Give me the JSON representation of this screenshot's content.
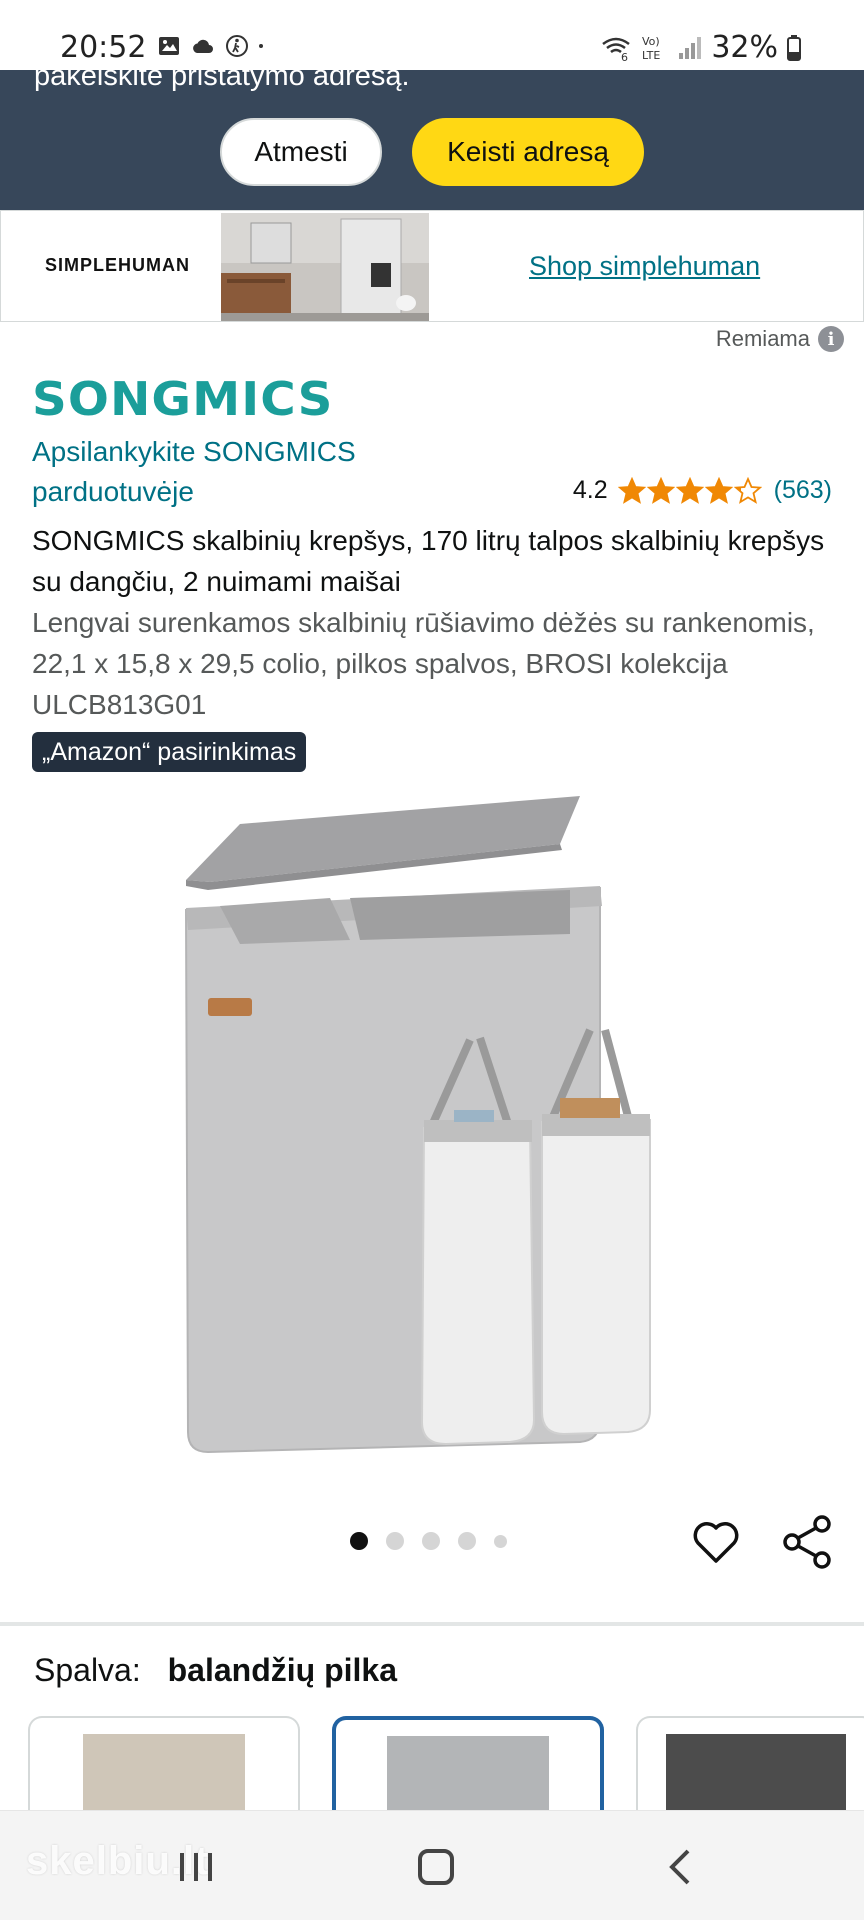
{
  "status_bar": {
    "time": "20:52",
    "battery": "32%",
    "network": "LTE",
    "icons": [
      "gallery-icon",
      "cloud-icon",
      "accessibility-icon",
      "wifi-calling-icon",
      "volte-icon",
      "signal-icon",
      "battery-icon"
    ]
  },
  "address_banner": {
    "text": "pakeiskite pristatymo adresą.",
    "dismiss_label": "Atmesti",
    "change_label": "Keisti adresą"
  },
  "brand_ad": {
    "logo_text": "SIMPLEHUMAN",
    "link_text": "Shop simplehuman"
  },
  "sponsored": {
    "label": "Remiama",
    "icon": "info-icon"
  },
  "product": {
    "brand_logo": "SONGMICS",
    "store_link": "Apsilankykite SONGMICS parduotuvėje",
    "rating_value": "4.2",
    "rating_stars": 4.2,
    "rating_count": "(563)",
    "title": "SONGMICS skalbinių krepšys, 170 litrų talpos skalbinių krepšys su dangčiu, 2 nuimami maišai",
    "subtitle": "Lengvai surenkamos skalbinių rūšiavimo dėžės su rankenomis, 22,1 x 15,8 x 29,5 colio, pilkos spalvos, BROSI kolekcija ULCB813G01",
    "badge": "„Amazon“ pasirinkimas",
    "image_count": 5,
    "active_image": 1
  },
  "variation": {
    "label": "Spalva:",
    "selected_value": "balandžių pilka",
    "swatches": [
      {
        "color": "#cfc6b8",
        "selected": false
      },
      {
        "color": "#b3b5b7",
        "selected": true
      },
      {
        "color": "#4c4c4c",
        "selected": false
      }
    ]
  },
  "nav_bar": {
    "watermark": "skelbiu.lt"
  },
  "colors": {
    "banner_bg": "#37475a",
    "primary_button": "#ffd814",
    "link": "#007185",
    "brand_teal": "#1b9e9a",
    "star": "#f08804",
    "badge_bg": "#232f3e",
    "selected_border": "#2162a1"
  }
}
